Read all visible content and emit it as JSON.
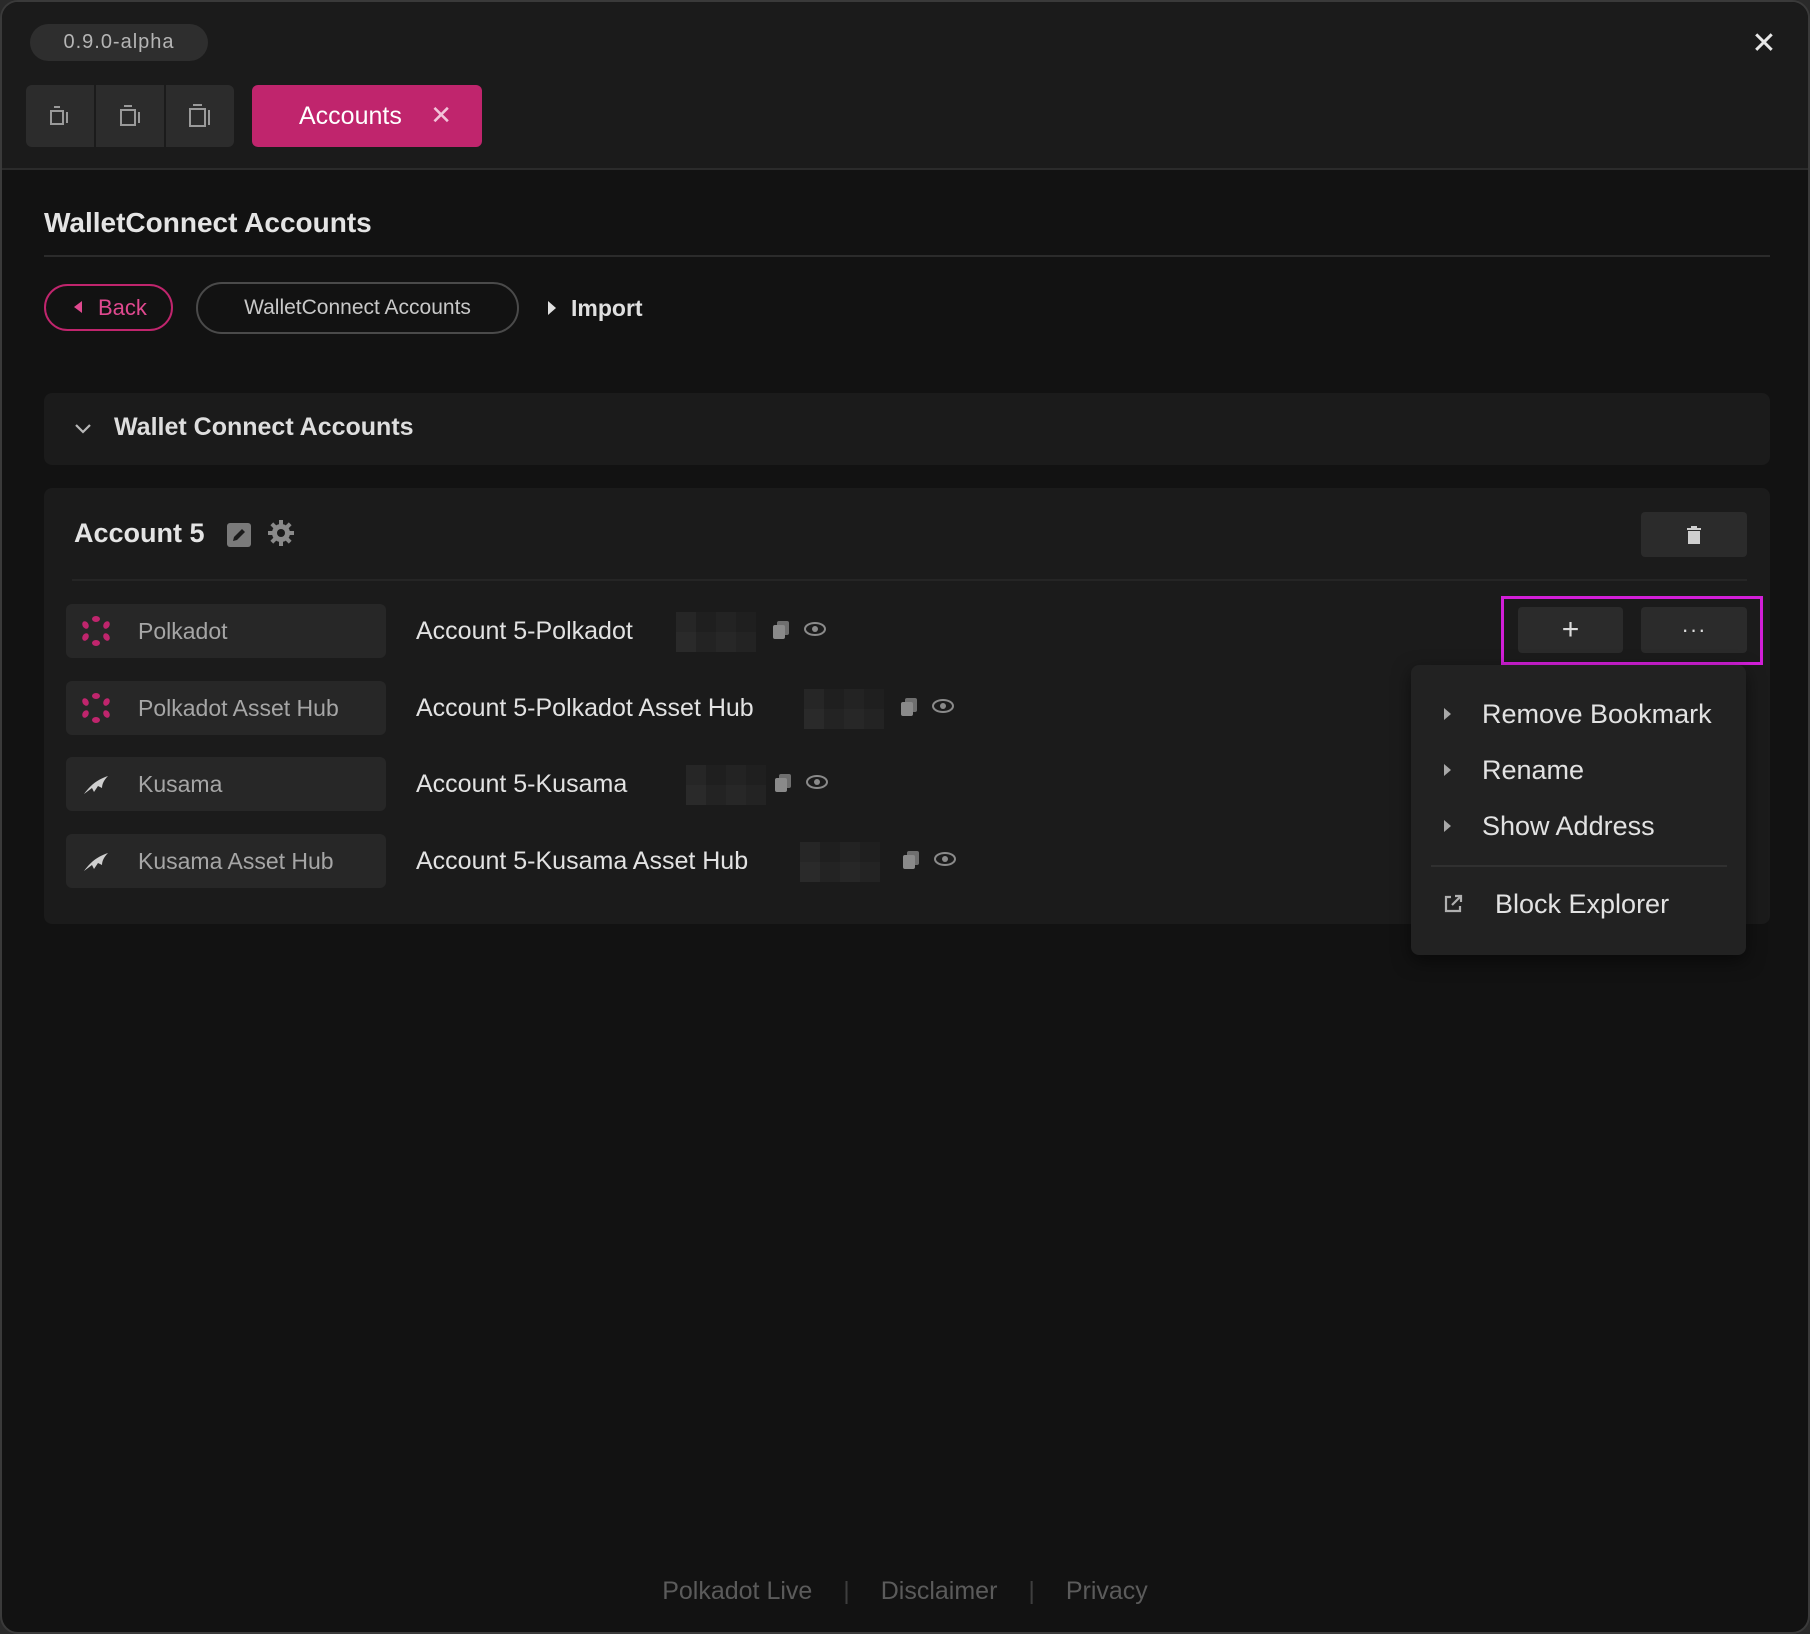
{
  "app": {
    "version": "0.9.0-alpha",
    "close_glyph": "✕"
  },
  "tabs": {
    "active_label": "Accounts",
    "close_glyph": "✕"
  },
  "toolbar": {
    "icons": [
      "layout-left-icon",
      "layout-center-icon",
      "layout-right-icon"
    ]
  },
  "page": {
    "title": "WalletConnect Accounts"
  },
  "breadcrumb": {
    "back_label": "Back",
    "current_label": "WalletConnect Accounts",
    "import_label": "Import"
  },
  "section": {
    "title": "Wallet Connect Accounts"
  },
  "account": {
    "name": "Account 5",
    "rows": [
      {
        "chain": "Polkadot",
        "account_name": "Account 5-Polkadot",
        "icon": "polkadot-icon"
      },
      {
        "chain": "Polkadot Asset Hub",
        "account_name": "Account 5-Polkadot Asset Hub",
        "icon": "polkadot-icon"
      },
      {
        "chain": "Kusama",
        "account_name": "Account 5-Kusama",
        "icon": "kusama-icon"
      },
      {
        "chain": "Kusama Asset Hub",
        "account_name": "Account 5-Kusama Asset Hub",
        "icon": "kusama-icon"
      }
    ]
  },
  "actions": {
    "add_glyph": "+",
    "more_glyph": "···"
  },
  "menu": {
    "items": [
      "Remove Bookmark",
      "Rename",
      "Show Address"
    ],
    "external_item": "Block Explorer"
  },
  "footer": {
    "links": [
      "Polkadot Live",
      "Disclaimer",
      "Privacy"
    ],
    "separator": "|"
  },
  "colors": {
    "accent": "#c0256d",
    "highlight_frame": "#d31fd9",
    "background": "#121212",
    "panel": "#1b1b1b"
  }
}
